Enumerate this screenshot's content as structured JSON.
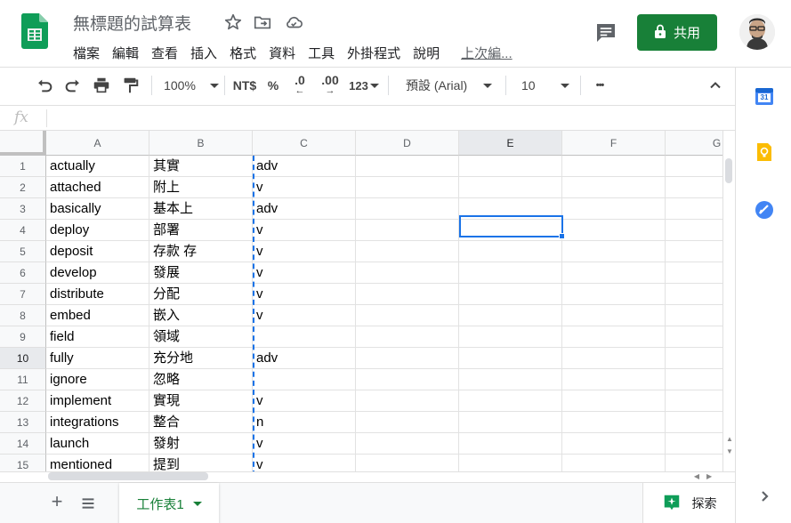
{
  "header": {
    "title": "無標題的試算表",
    "share_label": "共用",
    "menu": [
      "檔案",
      "編輯",
      "查看",
      "插入",
      "格式",
      "資料",
      "工具",
      "外掛程式",
      "說明",
      "上次編..."
    ]
  },
  "toolbar": {
    "zoom": "100%",
    "currency": "NT$",
    "percent": "%",
    "decrease_decimal": ".0",
    "increase_decimal": ".00",
    "more_formats": "123",
    "font": "預設 (Arial)",
    "font_size": "10",
    "more": "•••"
  },
  "formula_bar": {
    "fx_label": "fx",
    "content": ""
  },
  "grid": {
    "columns": [
      "A",
      "B",
      "C",
      "D",
      "E",
      "F",
      "G"
    ],
    "active_column": "E",
    "active_row": 10,
    "rows": [
      {
        "num": "1",
        "a": "actually",
        "b": "其實",
        "c": "adv"
      },
      {
        "num": "2",
        "a": "attached",
        "b": "附上",
        "c": "v"
      },
      {
        "num": "3",
        "a": "basically",
        "b": "基本上",
        "c": "adv"
      },
      {
        "num": "4",
        "a": "deploy",
        "b": "部署",
        "c": "v"
      },
      {
        "num": "5",
        "a": "deposit",
        "b": "存款 存",
        "c": "v"
      },
      {
        "num": "6",
        "a": "develop",
        "b": "發展",
        "c": "v"
      },
      {
        "num": "7",
        "a": "distribute",
        "b": "分配",
        "c": "v"
      },
      {
        "num": "8",
        "a": "embed",
        "b": "嵌入",
        "c": "v"
      },
      {
        "num": "9",
        "a": "field",
        "b": "領域",
        "c": ""
      },
      {
        "num": "10",
        "a": "fully",
        "b": "充分地",
        "c": "adv"
      },
      {
        "num": "11",
        "a": "ignore",
        "b": "忽略",
        "c": ""
      },
      {
        "num": "12",
        "a": "implement",
        "b": "實現",
        "c": "v"
      },
      {
        "num": "13",
        "a": "integrations",
        "b": "整合",
        "c": "n"
      },
      {
        "num": "14",
        "a": "launch",
        "b": "發射",
        "c": "v"
      },
      {
        "num": "15",
        "a": "mentioned",
        "b": "提到",
        "c": "v"
      }
    ]
  },
  "sheets": {
    "active_tab": "工作表1",
    "explore_label": "探索"
  },
  "side_panel": {
    "calendar_day": "31",
    "icons": [
      "calendar-icon",
      "keep-icon",
      "tasks-icon",
      "expand-icon"
    ]
  },
  "colors": {
    "accent_green": "#188038",
    "selection_blue": "#1a73e8"
  }
}
